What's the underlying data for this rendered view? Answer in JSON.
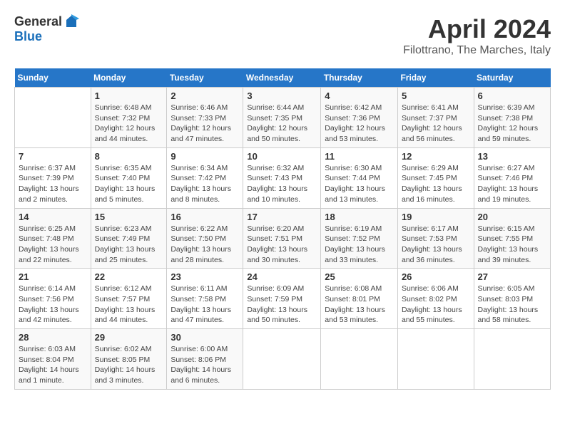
{
  "logo": {
    "general": "General",
    "blue": "Blue"
  },
  "title": "April 2024",
  "location": "Filottrano, The Marches, Italy",
  "days_header": [
    "Sunday",
    "Monday",
    "Tuesday",
    "Wednesday",
    "Thursday",
    "Friday",
    "Saturday"
  ],
  "weeks": [
    [
      {
        "day": "",
        "sunrise": "",
        "sunset": "",
        "daylight": ""
      },
      {
        "day": "1",
        "sunrise": "Sunrise: 6:48 AM",
        "sunset": "Sunset: 7:32 PM",
        "daylight": "Daylight: 12 hours and 44 minutes."
      },
      {
        "day": "2",
        "sunrise": "Sunrise: 6:46 AM",
        "sunset": "Sunset: 7:33 PM",
        "daylight": "Daylight: 12 hours and 47 minutes."
      },
      {
        "day": "3",
        "sunrise": "Sunrise: 6:44 AM",
        "sunset": "Sunset: 7:35 PM",
        "daylight": "Daylight: 12 hours and 50 minutes."
      },
      {
        "day": "4",
        "sunrise": "Sunrise: 6:42 AM",
        "sunset": "Sunset: 7:36 PM",
        "daylight": "Daylight: 12 hours and 53 minutes."
      },
      {
        "day": "5",
        "sunrise": "Sunrise: 6:41 AM",
        "sunset": "Sunset: 7:37 PM",
        "daylight": "Daylight: 12 hours and 56 minutes."
      },
      {
        "day": "6",
        "sunrise": "Sunrise: 6:39 AM",
        "sunset": "Sunset: 7:38 PM",
        "daylight": "Daylight: 12 hours and 59 minutes."
      }
    ],
    [
      {
        "day": "7",
        "sunrise": "Sunrise: 6:37 AM",
        "sunset": "Sunset: 7:39 PM",
        "daylight": "Daylight: 13 hours and 2 minutes."
      },
      {
        "day": "8",
        "sunrise": "Sunrise: 6:35 AM",
        "sunset": "Sunset: 7:40 PM",
        "daylight": "Daylight: 13 hours and 5 minutes."
      },
      {
        "day": "9",
        "sunrise": "Sunrise: 6:34 AM",
        "sunset": "Sunset: 7:42 PM",
        "daylight": "Daylight: 13 hours and 8 minutes."
      },
      {
        "day": "10",
        "sunrise": "Sunrise: 6:32 AM",
        "sunset": "Sunset: 7:43 PM",
        "daylight": "Daylight: 13 hours and 10 minutes."
      },
      {
        "day": "11",
        "sunrise": "Sunrise: 6:30 AM",
        "sunset": "Sunset: 7:44 PM",
        "daylight": "Daylight: 13 hours and 13 minutes."
      },
      {
        "day": "12",
        "sunrise": "Sunrise: 6:29 AM",
        "sunset": "Sunset: 7:45 PM",
        "daylight": "Daylight: 13 hours and 16 minutes."
      },
      {
        "day": "13",
        "sunrise": "Sunrise: 6:27 AM",
        "sunset": "Sunset: 7:46 PM",
        "daylight": "Daylight: 13 hours and 19 minutes."
      }
    ],
    [
      {
        "day": "14",
        "sunrise": "Sunrise: 6:25 AM",
        "sunset": "Sunset: 7:48 PM",
        "daylight": "Daylight: 13 hours and 22 minutes."
      },
      {
        "day": "15",
        "sunrise": "Sunrise: 6:23 AM",
        "sunset": "Sunset: 7:49 PM",
        "daylight": "Daylight: 13 hours and 25 minutes."
      },
      {
        "day": "16",
        "sunrise": "Sunrise: 6:22 AM",
        "sunset": "Sunset: 7:50 PM",
        "daylight": "Daylight: 13 hours and 28 minutes."
      },
      {
        "day": "17",
        "sunrise": "Sunrise: 6:20 AM",
        "sunset": "Sunset: 7:51 PM",
        "daylight": "Daylight: 13 hours and 30 minutes."
      },
      {
        "day": "18",
        "sunrise": "Sunrise: 6:19 AM",
        "sunset": "Sunset: 7:52 PM",
        "daylight": "Daylight: 13 hours and 33 minutes."
      },
      {
        "day": "19",
        "sunrise": "Sunrise: 6:17 AM",
        "sunset": "Sunset: 7:53 PM",
        "daylight": "Daylight: 13 hours and 36 minutes."
      },
      {
        "day": "20",
        "sunrise": "Sunrise: 6:15 AM",
        "sunset": "Sunset: 7:55 PM",
        "daylight": "Daylight: 13 hours and 39 minutes."
      }
    ],
    [
      {
        "day": "21",
        "sunrise": "Sunrise: 6:14 AM",
        "sunset": "Sunset: 7:56 PM",
        "daylight": "Daylight: 13 hours and 42 minutes."
      },
      {
        "day": "22",
        "sunrise": "Sunrise: 6:12 AM",
        "sunset": "Sunset: 7:57 PM",
        "daylight": "Daylight: 13 hours and 44 minutes."
      },
      {
        "day": "23",
        "sunrise": "Sunrise: 6:11 AM",
        "sunset": "Sunset: 7:58 PM",
        "daylight": "Daylight: 13 hours and 47 minutes."
      },
      {
        "day": "24",
        "sunrise": "Sunrise: 6:09 AM",
        "sunset": "Sunset: 7:59 PM",
        "daylight": "Daylight: 13 hours and 50 minutes."
      },
      {
        "day": "25",
        "sunrise": "Sunrise: 6:08 AM",
        "sunset": "Sunset: 8:01 PM",
        "daylight": "Daylight: 13 hours and 53 minutes."
      },
      {
        "day": "26",
        "sunrise": "Sunrise: 6:06 AM",
        "sunset": "Sunset: 8:02 PM",
        "daylight": "Daylight: 13 hours and 55 minutes."
      },
      {
        "day": "27",
        "sunrise": "Sunrise: 6:05 AM",
        "sunset": "Sunset: 8:03 PM",
        "daylight": "Daylight: 13 hours and 58 minutes."
      }
    ],
    [
      {
        "day": "28",
        "sunrise": "Sunrise: 6:03 AM",
        "sunset": "Sunset: 8:04 PM",
        "daylight": "Daylight: 14 hours and 1 minute."
      },
      {
        "day": "29",
        "sunrise": "Sunrise: 6:02 AM",
        "sunset": "Sunset: 8:05 PM",
        "daylight": "Daylight: 14 hours and 3 minutes."
      },
      {
        "day": "30",
        "sunrise": "Sunrise: 6:00 AM",
        "sunset": "Sunset: 8:06 PM",
        "daylight": "Daylight: 14 hours and 6 minutes."
      },
      {
        "day": "",
        "sunrise": "",
        "sunset": "",
        "daylight": ""
      },
      {
        "day": "",
        "sunrise": "",
        "sunset": "",
        "daylight": ""
      },
      {
        "day": "",
        "sunrise": "",
        "sunset": "",
        "daylight": ""
      },
      {
        "day": "",
        "sunrise": "",
        "sunset": "",
        "daylight": ""
      }
    ]
  ]
}
